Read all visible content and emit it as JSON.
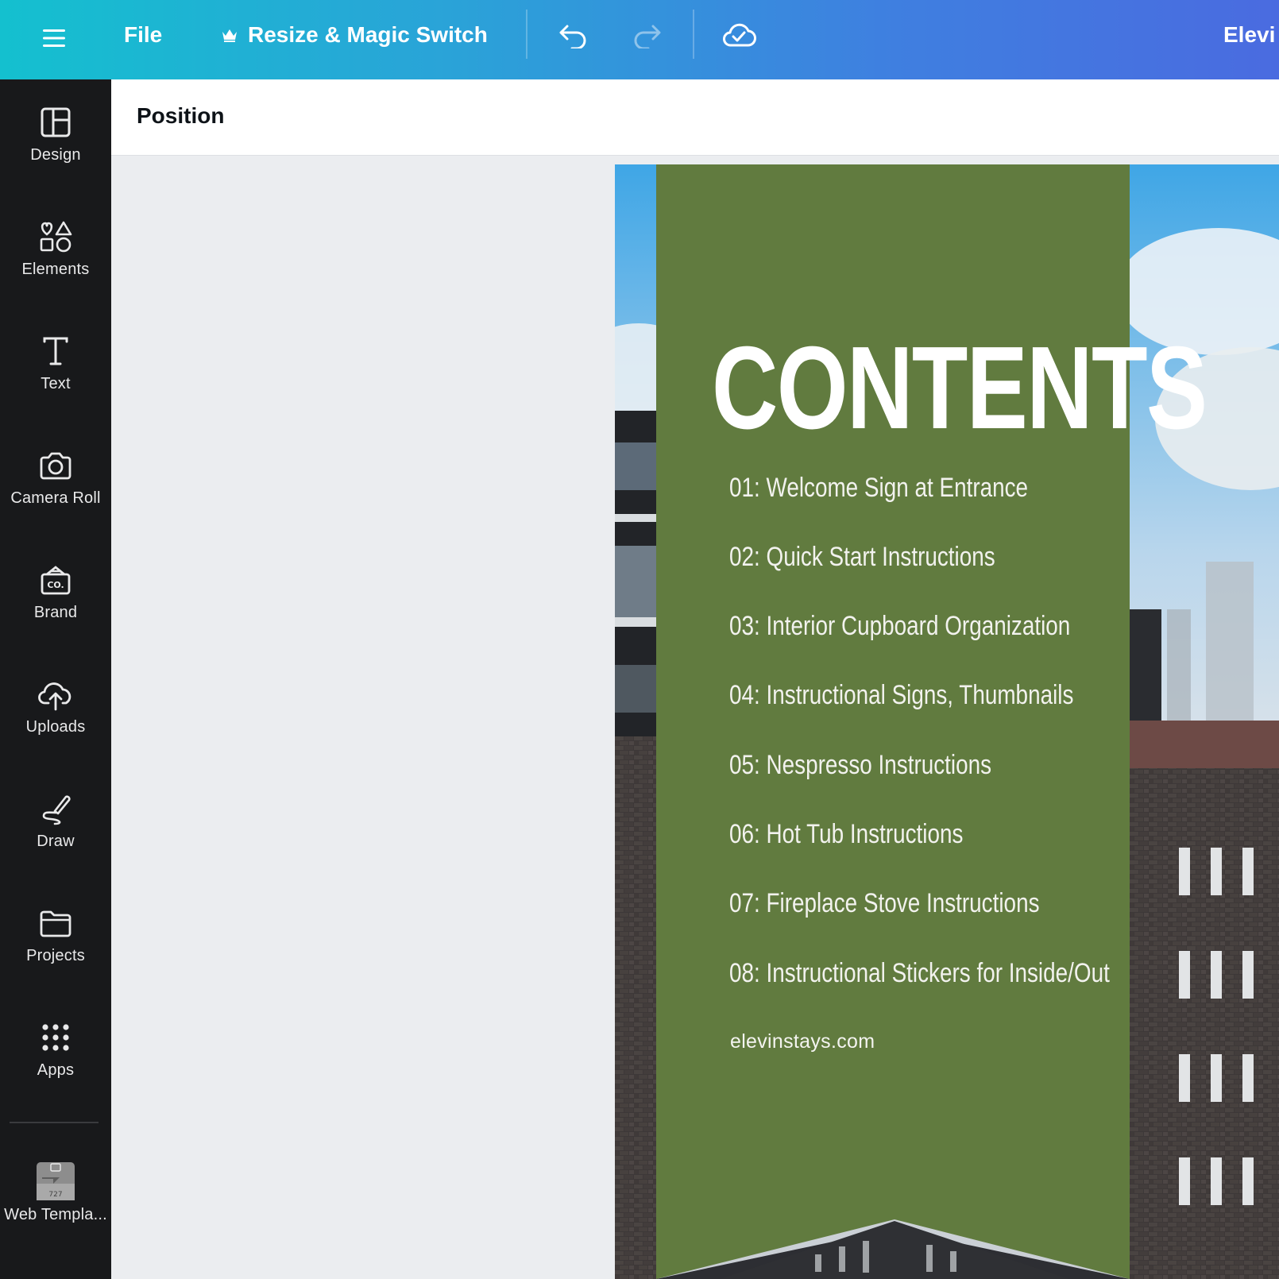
{
  "topbar": {
    "file_label": "File",
    "resize_label": "Resize & Magic Switch",
    "doc_title": "Elevi"
  },
  "context_bar": {
    "position_label": "Position"
  },
  "sidebar": {
    "items": [
      {
        "label": "Design",
        "icon": "design-icon"
      },
      {
        "label": "Elements",
        "icon": "elements-icon"
      },
      {
        "label": "Text",
        "icon": "text-icon"
      },
      {
        "label": "Camera Roll",
        "icon": "camera-icon"
      },
      {
        "label": "Brand",
        "icon": "brand-icon"
      },
      {
        "label": "Uploads",
        "icon": "upload-cloud-icon"
      },
      {
        "label": "Draw",
        "icon": "draw-icon"
      },
      {
        "label": "Projects",
        "icon": "folder-icon"
      },
      {
        "label": "Apps",
        "icon": "apps-grid-icon"
      },
      {
        "label": "Web Templa...",
        "icon": "web-template-thumbnail"
      }
    ]
  },
  "design": {
    "title": "CONTENTS",
    "toc": [
      "01: Welcome Sign at Entrance",
      "02: Quick Start Instructions",
      "03: Interior Cupboard Organization",
      "04: Instructional Signs, Thumbnails",
      "05: Nespresso Instructions",
      "06: Hot Tub Instructions",
      "07: Fireplace Stove Instructions",
      "08: Instructional Stickers for Inside/Out"
    ],
    "website": "elevinstays.com",
    "panel_color": "#617b3f"
  }
}
